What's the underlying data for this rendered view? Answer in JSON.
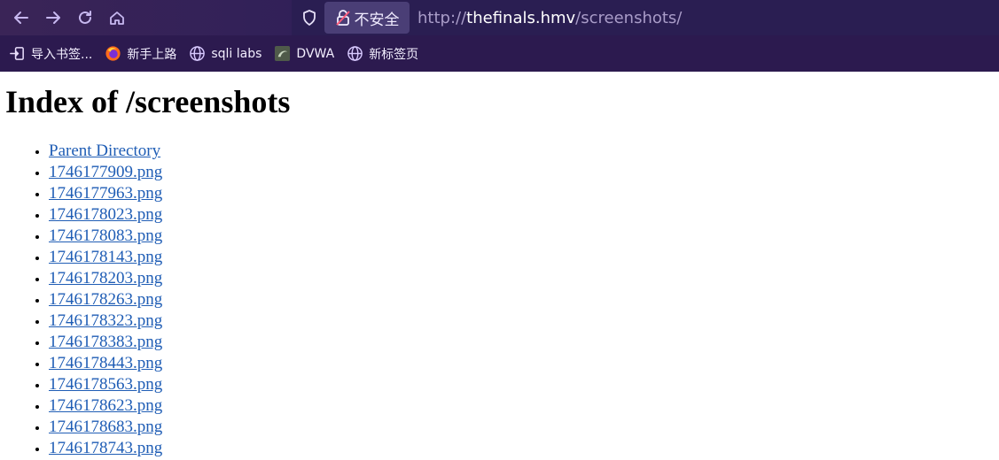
{
  "browser": {
    "security_label": "不安全",
    "url_scheme": "http://",
    "url_host": "thefinals.hmv",
    "url_path": "/screenshots/"
  },
  "bookmarks": [
    {
      "label": "导入书签...",
      "icon": "import-icon"
    },
    {
      "label": "新手上路",
      "icon": "firefox-icon"
    },
    {
      "label": "sqli labs",
      "icon": "globe-icon"
    },
    {
      "label": "DVWA",
      "icon": "dvwa-icon"
    },
    {
      "label": "新标签页",
      "icon": "globe-icon"
    }
  ],
  "page": {
    "title": "Index of /screenshots",
    "items": [
      "Parent Directory",
      "1746177909.png",
      "1746177963.png",
      "1746178023.png",
      "1746178083.png",
      "1746178143.png",
      "1746178203.png",
      "1746178263.png",
      "1746178323.png",
      "1746178383.png",
      "1746178443.png",
      "1746178563.png",
      "1746178623.png",
      "1746178683.png",
      "1746178743.png"
    ]
  },
  "colors": {
    "toolbar": "#2e1f58",
    "bookmarks_bar": "#2c1a4f",
    "link": "#1f5db5"
  }
}
